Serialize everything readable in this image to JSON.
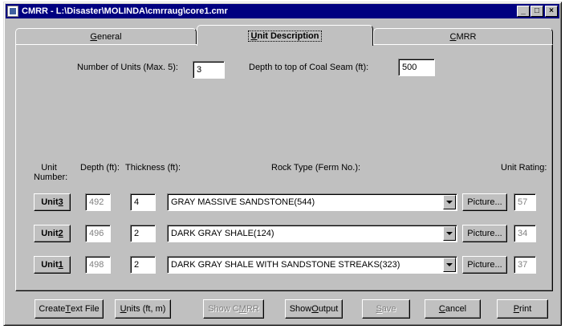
{
  "window": {
    "title": "CMRR - L:\\Disaster\\MOLINDA\\cmrraug\\core1.cmr",
    "min_label": "_",
    "max_label": "□",
    "close_label": "×"
  },
  "tabs": [
    {
      "pre": "",
      "key": "G",
      "post": "eneral"
    },
    {
      "pre": "",
      "key": "U",
      "post": "nit Description"
    },
    {
      "pre": "",
      "key": "C",
      "post": "MRR"
    }
  ],
  "form": {
    "num_units_label": "Number of Units (Max. 5):",
    "num_units_value": "3",
    "depth_label": "Depth to top of Coal Seam (ft):",
    "depth_value": "500"
  },
  "columns": {
    "unit_number": "Unit\nNumber:",
    "depth": "Depth (ft):",
    "thickness": "Thickness (ft):",
    "rock_type": "Rock Type (Ferm No.):",
    "unit_rating": "Unit Rating:"
  },
  "units": [
    {
      "pre": "Unit ",
      "key": "3",
      "depth": "492",
      "thickness": "4",
      "rock": "GRAY MASSIVE SANDSTONE(544)",
      "picture": "Picture...",
      "rating": "57"
    },
    {
      "pre": "Unit ",
      "key": "2",
      "depth": "496",
      "thickness": "2",
      "rock": "DARK GRAY SHALE(124)",
      "picture": "Picture...",
      "rating": "34"
    },
    {
      "pre": "Unit ",
      "key": "1",
      "depth": "498",
      "thickness": "2",
      "rock": "DARK GRAY SHALE WITH SANDSTONE STREAKS(323)",
      "picture": "Picture...",
      "rating": "37"
    }
  ],
  "buttons": {
    "create": {
      "pre": "Create ",
      "key": "T",
      "post": "ext File"
    },
    "units": {
      "pre": "",
      "key": "U",
      "post": "nits (ft, m)"
    },
    "show_cmrr": {
      "pre": "Show C",
      "key": "M",
      "post": "RR"
    },
    "show_output": {
      "pre": "Show ",
      "key": "O",
      "post": "utput"
    },
    "save": {
      "pre": "",
      "key": "S",
      "post": "ave"
    },
    "cancel": {
      "pre": "",
      "key": "C",
      "post": "ancel"
    },
    "print": {
      "pre": "",
      "key": "P",
      "post": "rint"
    }
  }
}
